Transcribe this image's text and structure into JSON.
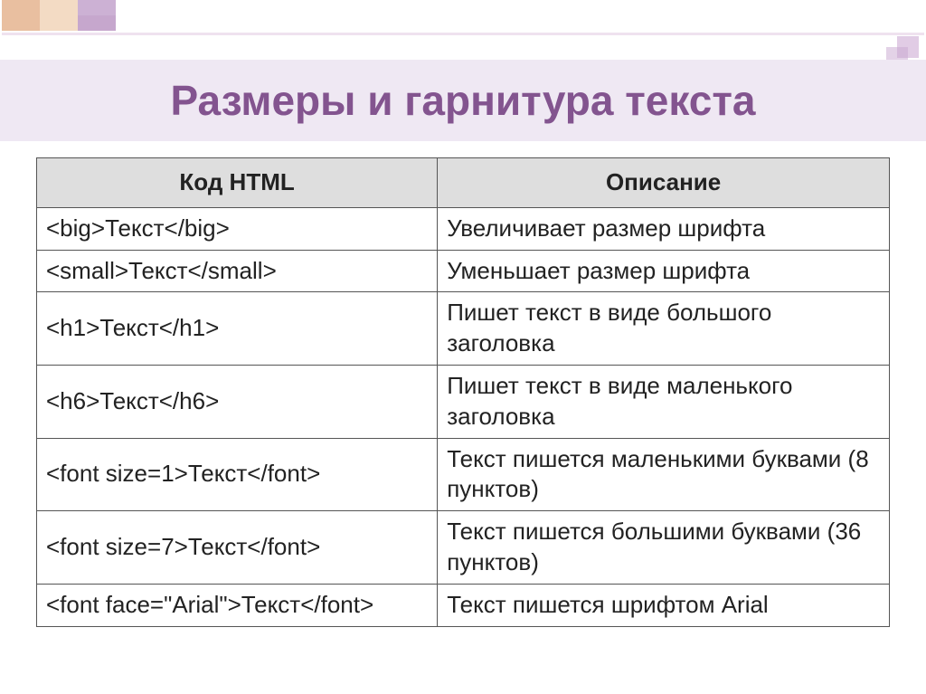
{
  "title": "Размеры и гарнитура текста",
  "table": {
    "headers": [
      "Код HTML",
      "Описание"
    ],
    "rows": [
      {
        "code": "<big>Текст</big>",
        "desc": "Увеличивает размер шрифта"
      },
      {
        "code": "<small>Текст</small>",
        "desc": "Уменьшает размер шрифта"
      },
      {
        "code": "<h1>Текст</h1>",
        "desc": "Пишет текст в виде большого заголовка"
      },
      {
        "code": "<h6>Текст</h6>",
        "desc": "Пишет текст в виде маленького заголовка"
      },
      {
        "code": "<font size=1>Текст</font>",
        "desc": "Текст пишется маленькими буквами  (8 пунктов)"
      },
      {
        "code": "<font size=7>Текст</font>",
        "desc": "Текст пишется большими буквами  (36 пунктов)"
      },
      {
        "code": "<font face=\"Arial\">Текст</font>",
        "desc": "Текст пишется шрифтом Arial"
      }
    ]
  }
}
